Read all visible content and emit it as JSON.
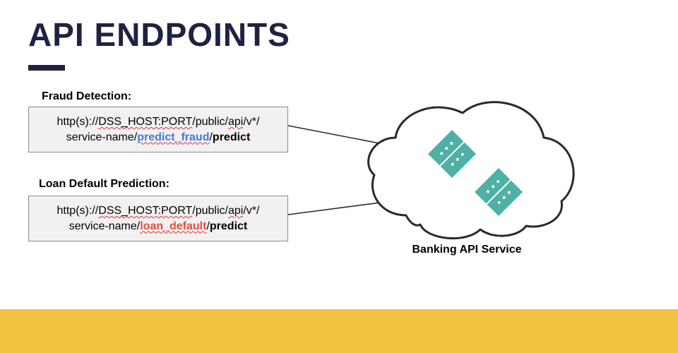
{
  "title": "API ENDPOINTS",
  "endpoints": {
    "fraud": {
      "label": "Fraud Detection:",
      "url_prefix": "http(s)://",
      "host": "DSS_HOST:PORT",
      "path1": "/public/",
      "api": "api",
      "path2": "/v*/",
      "line2_prefix": "service-name/",
      "keyword": "predict_fraud",
      "line2_suffix": "/",
      "action": "predict"
    },
    "loan": {
      "label": "Loan Default Prediction:",
      "url_prefix": "http(s)://",
      "host": "DSS_HOST:PORT",
      "path1": "/public/",
      "api": "api",
      "path2": "/v*/",
      "line2_prefix": "service-name/",
      "keyword": "loan_default",
      "line2_suffix": "/",
      "action": "predict"
    }
  },
  "cloud_label": "Banking API Service",
  "colors": {
    "title": "#1f2240",
    "accent_yellow": "#f0c340",
    "kw_blue": "#4776e6",
    "kw_red": "#e94b3c",
    "cloud_stroke": "#2a2a2a",
    "chip_fill": "#4fb0a5"
  }
}
